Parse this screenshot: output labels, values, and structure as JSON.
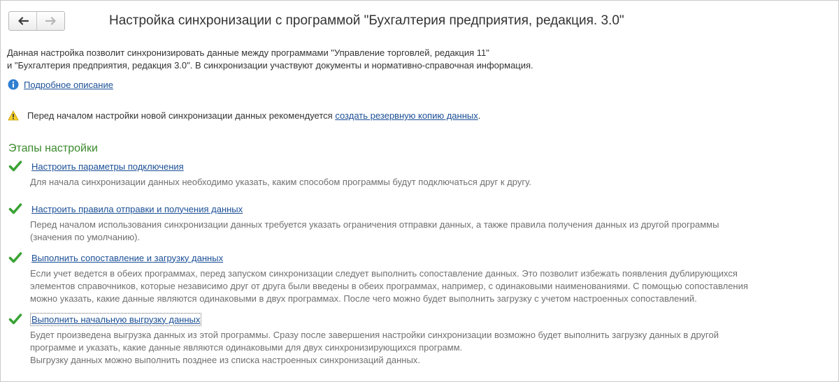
{
  "window": {
    "title": "Настройка синхронизации с программой \"Бухгалтерия предприятия, редакция. 3.0\""
  },
  "nav": {
    "back_icon": "arrow-left-icon",
    "forward_icon": "arrow-right-icon"
  },
  "intro": {
    "line1": "Данная настройка позволит синхронизировать данные между программами \"Управление торговлей, редакция 11\"",
    "line2": "и \"Бухгалтерия предприятия, редакция 3.0\".  В синхронизации участвуют документы и нормативно-справочная информация."
  },
  "details": {
    "icon": "info-icon",
    "link": "Подробное описание"
  },
  "warning": {
    "icon": "warning-icon",
    "text": "Перед началом настройки новой синхронизации данных рекомендуется",
    "link": "создать резервную копию данных",
    "suffix": "."
  },
  "steps_title": "Этапы настройки",
  "steps": [
    {
      "link": "Настроить параметры подключения",
      "desc": [
        "Для начала синхронизации данных необходимо указать, каким способом программы будут подключаться друг к другу."
      ]
    },
    {
      "link": "Настроить правила отправки и получения данных",
      "desc": [
        "Перед началом использования синхронизации данных требуется указать ограничения отправки данных, а также правила получения данных из другой программы",
        "(значения по умолчанию)."
      ]
    },
    {
      "link": "Выполнить сопоставление и загрузку данных",
      "desc": [
        "Если учет ведется в обеих программах, перед запуском синхронизации следует выполнить сопоставление данных. Это позволит избежать появления дублирующихся",
        "элементов справочников, которые независимо друг от друга были введены в обеих программах, например, с одинаковыми наименованиями. С помощью сопоставления",
        "можно указать, какие данные являются одинаковыми в двух программах. После чего можно будет выполнить загрузку с учетом настроенных сопоставлений."
      ]
    },
    {
      "link": "Выполнить начальную выгрузку данных",
      "desc": [
        "Будет произведена выгрузка данных из этой программы. Сразу после завершения настройки синхронизации возможно будет выполнить загрузку данных в другой",
        "программе и указать, какие данные являются одинаковыми для двух синхронизирующихся программ.",
        "Выгрузку данных можно выполнить позднее из списка настроенных синхронизаций данных."
      ]
    }
  ],
  "colors": {
    "link": "#1b4f96",
    "section_title": "#3a8a2c",
    "check": "#3aa335",
    "description": "#707070"
  }
}
